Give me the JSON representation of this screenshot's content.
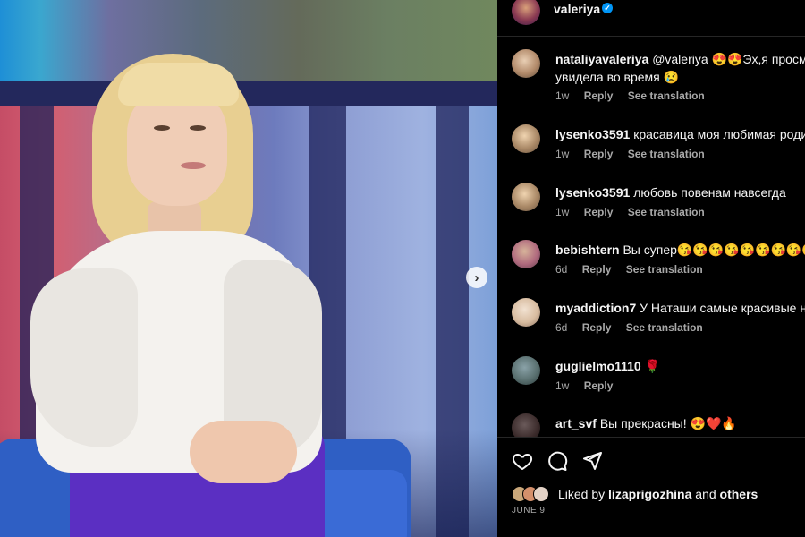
{
  "post": {
    "carousel_next_glyph": "›"
  },
  "header": {
    "username": "valeriya",
    "verified": true
  },
  "comments": [
    {
      "username": "nataliyavaleriya",
      "text_line1": "@valeriya 😍😍Эх,я просмо",
      "text_line2": "увидела во время 😢",
      "age": "1w",
      "reply": "Reply",
      "translate": "See translation"
    },
    {
      "username": "lysenko3591",
      "text_line1": "красавица моя любимая роди",
      "age": "1w",
      "reply": "Reply",
      "translate": "See translation"
    },
    {
      "username": "lysenko3591",
      "text_line1": "любовь повенам навсегда",
      "age": "1w",
      "reply": "Reply",
      "translate": "See translation"
    },
    {
      "username": "bebishtern",
      "text_line1": "Вы супер😘😘😘😘😘😘😘😘😘👍👍",
      "age": "6d",
      "reply": "Reply",
      "translate": "See translation"
    },
    {
      "username": "myaddiction7",
      "text_line1": "У Наташи самые красивые н",
      "age": "6d",
      "reply": "Reply",
      "translate": "See translation"
    },
    {
      "username": "guglielmo1110",
      "text_line1": "🌹",
      "age": "1w",
      "reply": "Reply"
    },
    {
      "username": "art_svf",
      "text_line1": "Вы прекрасны! 😍❤️🔥"
    }
  ],
  "actions": {
    "liked_prefix": "Liked by",
    "liked_user": "lizaprigozhina",
    "liked_and": "and",
    "liked_others": "others",
    "date": "JUNE 9"
  },
  "colors": {
    "accent_verified": "#0095f6",
    "secondary_text": "#a8a8a8"
  }
}
